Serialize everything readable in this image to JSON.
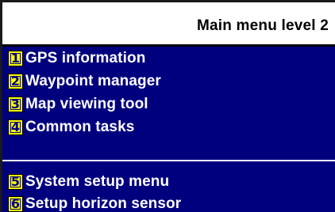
{
  "header": {
    "title": "Main menu level 2"
  },
  "menu": {
    "items": [
      {
        "key": "1",
        "label": "GPS information"
      },
      {
        "key": "2",
        "label": "Waypoint manager"
      },
      {
        "key": "3",
        "label": "Map viewing tool"
      },
      {
        "key": "4",
        "label": "Common tasks"
      },
      {
        "key": "5",
        "label": "System setup menu"
      },
      {
        "key": "6",
        "label": "Setup horizon sensor"
      }
    ]
  },
  "colors": {
    "panel_background": "#00007f",
    "key_background": "#ffff00",
    "label_text": "#ffffff",
    "title_text": "#000000"
  }
}
